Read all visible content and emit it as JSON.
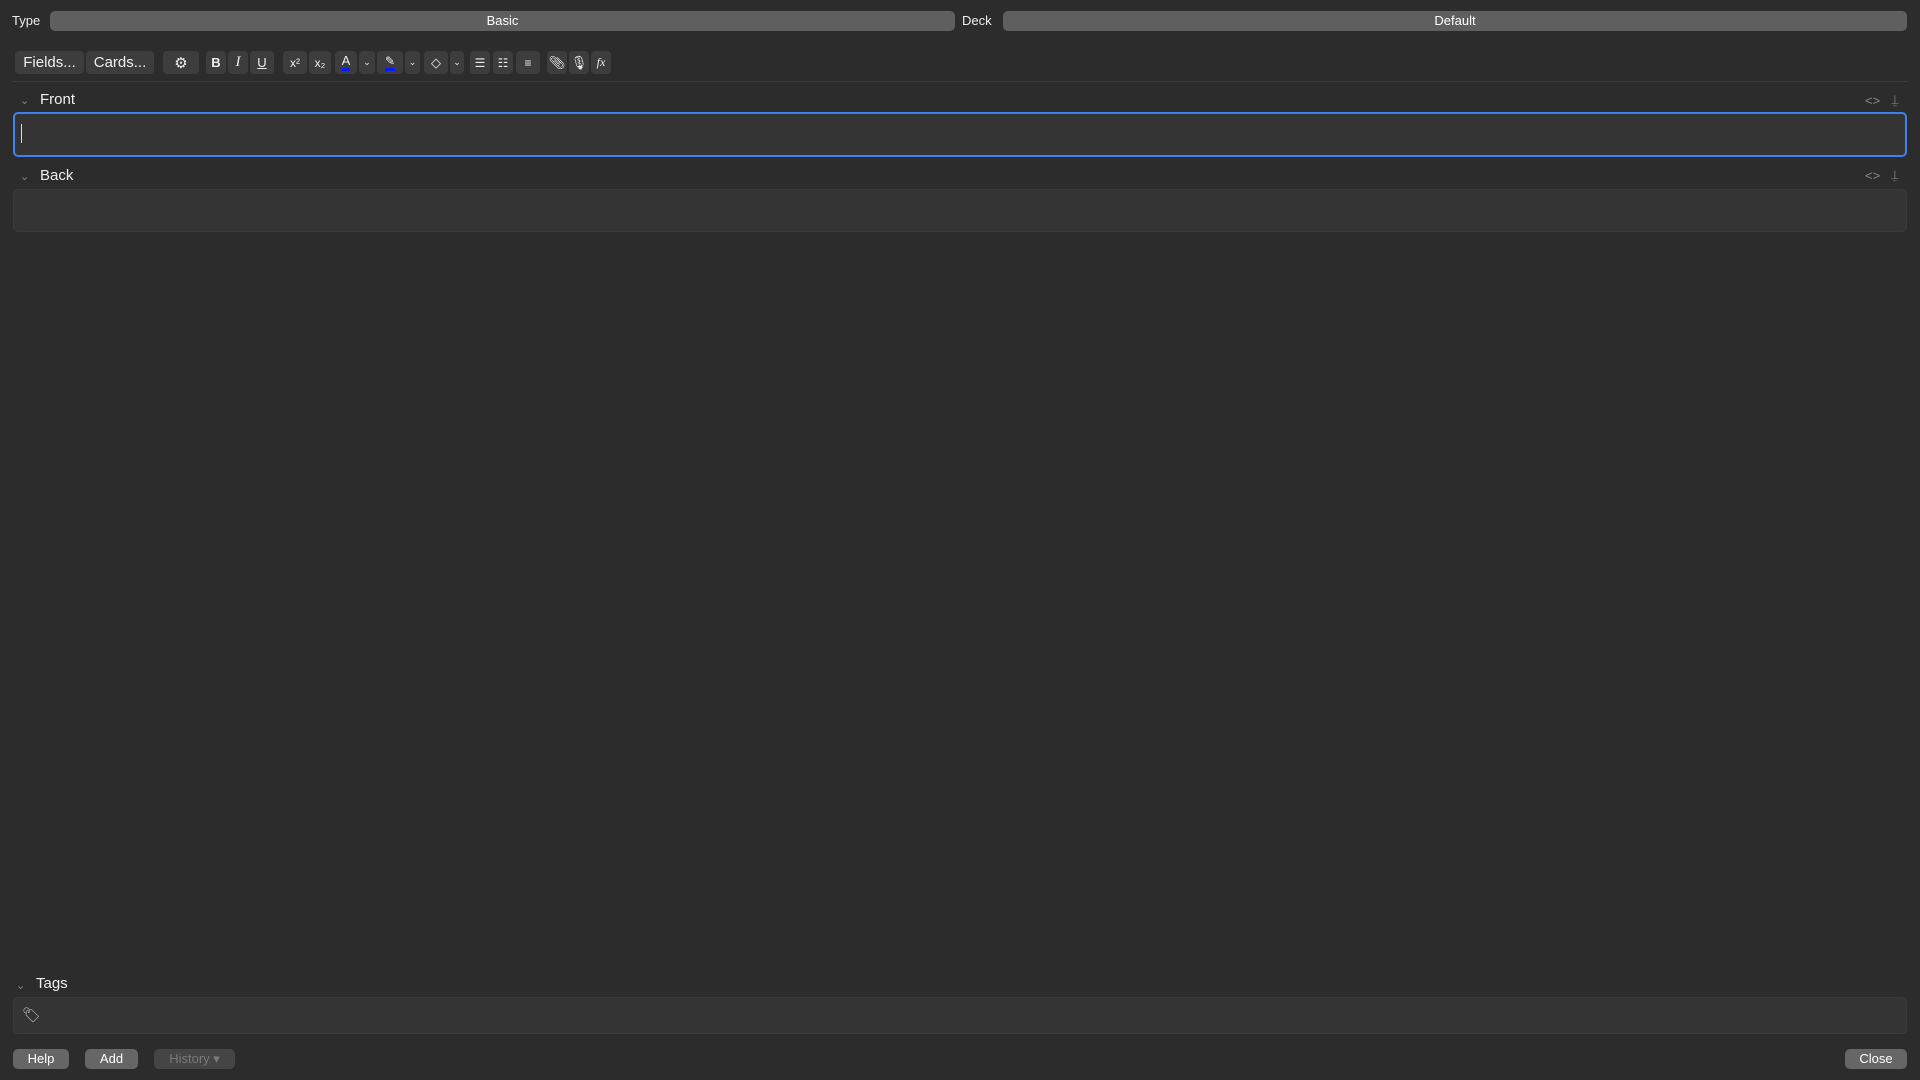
{
  "header": {
    "type_label": "Type",
    "type_value": "Basic",
    "deck_label": "Deck",
    "deck_value": "Default"
  },
  "toolbar": {
    "fields": "Fields...",
    "cards": "Cards...",
    "bold": "B",
    "italic": "I",
    "underline": "U",
    "text_color": "#0a18ff",
    "highlight_color": "#0a18ff"
  },
  "fields": [
    {
      "label": "Front",
      "value": ""
    },
    {
      "label": "Back",
      "value": ""
    }
  ],
  "tags": {
    "label": "Tags",
    "value": ""
  },
  "footer": {
    "help": "Help",
    "add": "Add",
    "history": "History ▾",
    "close": "Close"
  },
  "colors": {
    "focus": "#3c82f0"
  }
}
